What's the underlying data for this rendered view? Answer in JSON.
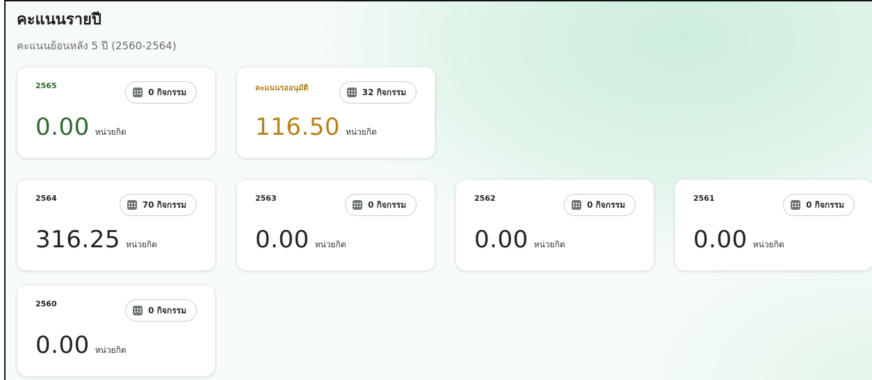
{
  "title": "คะแนนรายปี",
  "subtitle": "คะแนนย้อนหลัง 5 ปี (2560-2564)",
  "unit_label": "หน่วยกิต",
  "colors": {
    "current_year": "#2e6b2e",
    "pending": "#b5821c"
  },
  "cards": [
    {
      "year": "2565",
      "activities": "0 กิจกรรม",
      "value": "0.00"
    },
    {
      "year": "คะแนนรออนุมัติ",
      "activities": "32 กิจกรรม",
      "value": "116.50"
    },
    {
      "year": "2564",
      "activities": "70 กิจกรรม",
      "value": "316.25"
    },
    {
      "year": "2563",
      "activities": "0 กิจกรรม",
      "value": "0.00"
    },
    {
      "year": "2562",
      "activities": "0 กิจกรรม",
      "value": "0.00"
    },
    {
      "year": "2561",
      "activities": "0 กิจกรรม",
      "value": "0.00"
    },
    {
      "year": "2560",
      "activities": "0 กิจกรรม",
      "value": "0.00"
    }
  ]
}
